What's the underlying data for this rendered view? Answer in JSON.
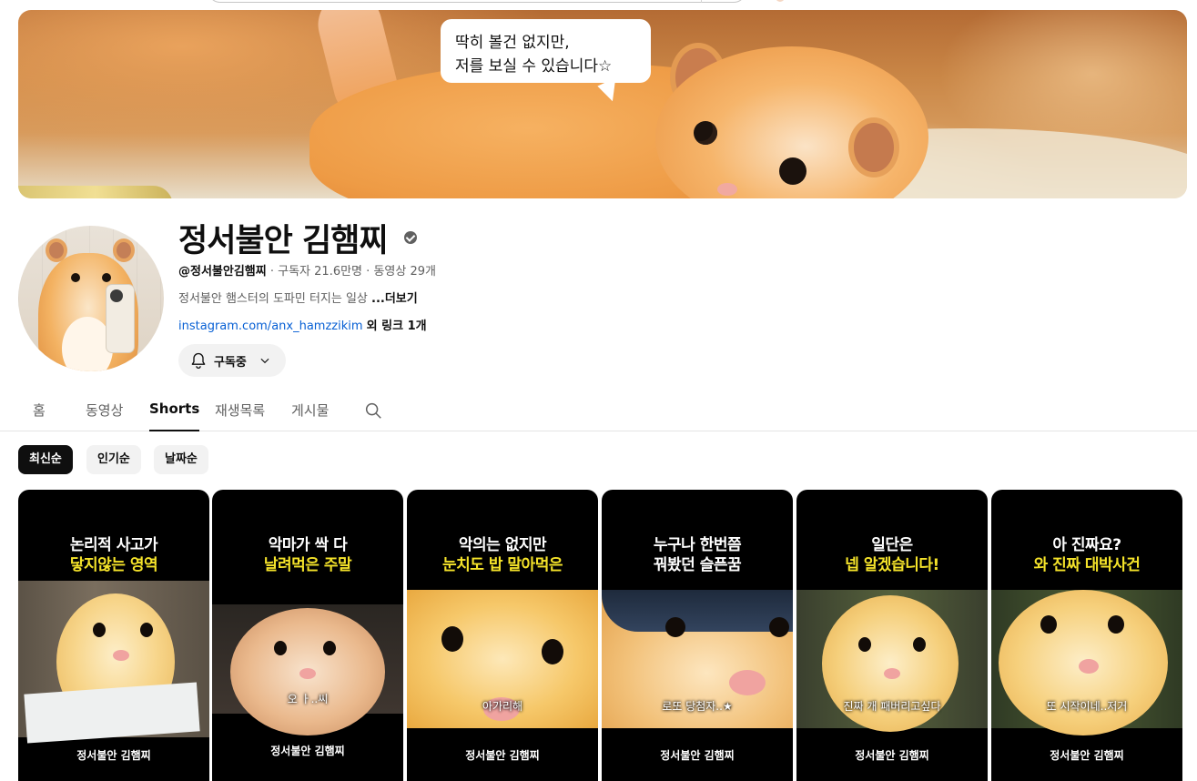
{
  "banner": {
    "bubble_line1": "딱히 볼건 없지만,",
    "bubble_line2": "저를 보실 수 있습니다☆"
  },
  "channel": {
    "name": "정서불안 김햄찌",
    "handle": "@정서불안김햄찌",
    "subscribers": "구독자 21.6만명",
    "videos": "동영상 29개",
    "description": "정서불안 햄스터의 도파민 터지는 일상",
    "more_label": "...더보기",
    "link": "instagram.com/anx_hamzzikim",
    "link_extra": "외 링크 1개",
    "subscribe_label": "구독중"
  },
  "tabs": [
    {
      "label": "홈"
    },
    {
      "label": "동영상"
    },
    {
      "label": "Shorts"
    },
    {
      "label": "재생목록"
    },
    {
      "label": "게시물"
    }
  ],
  "active_tab": "Shorts",
  "chips": [
    {
      "label": "최신순"
    },
    {
      "label": "인기순"
    },
    {
      "label": "날짜순"
    }
  ],
  "active_chip": "최신순",
  "shorts": [
    {
      "caption_white": "논리적 사고가",
      "caption_yellow": "닿지않는 영역",
      "subtitle": "",
      "brand": "정서불안 김햄찌"
    },
    {
      "caption_white": "악마가 싹 다",
      "caption_yellow": "날려먹은 주말",
      "subtitle": "오 ㅏ..씨",
      "brand": "정서불안 김햄찌"
    },
    {
      "caption_white": "악의는 없지만",
      "caption_yellow": "눈치도 밥 말아먹은",
      "subtitle": "아가리해",
      "brand": "정서불안 김햄찌"
    },
    {
      "caption_white": "누구나 한번쯤",
      "caption_yellow": "꿔봤던 슬픈꿈",
      "subtitle": "로또 당첨자..★",
      "brand": "정서불안 김햄찌"
    },
    {
      "caption_white": "일단은",
      "caption_yellow": "넵 알겠습니다!",
      "subtitle": "진짜 개 패버리고싶다",
      "brand": "정서불안 김햄찌"
    },
    {
      "caption_white": "아 진짜요?",
      "caption_yellow": "와 진짜 대박사건",
      "subtitle": "또 시작이네..저거",
      "brand": "정서불안 김햄찌"
    }
  ],
  "colors": {
    "link": "#065fd4",
    "caption_yellow": "#f5e32a",
    "active_chip_bg": "#0f0f0f"
  },
  "icons": [
    "verified-icon",
    "bell-icon",
    "chevron-down-icon",
    "search-icon"
  ]
}
